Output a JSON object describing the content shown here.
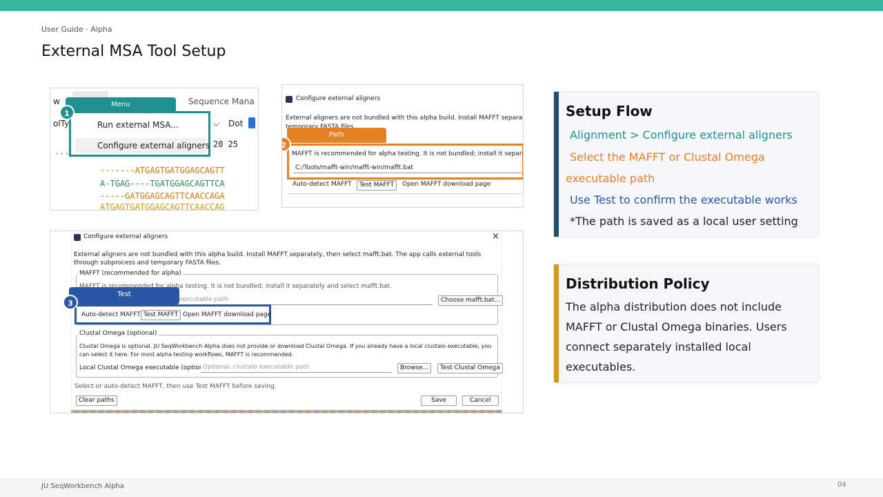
{
  "header": {
    "guide_label": "User Guide · Alpha",
    "title": "External MSA Tool Setup"
  },
  "footer": {
    "app_name": "JU SeqWorkbench Alpha",
    "page_number": "04"
  },
  "shot1": {
    "tab_sequence": "Sequence Mana",
    "menu_tag": "Menu",
    "step": "1",
    "menu_items": [
      "Run external MSA...",
      "Configure external aligners"
    ],
    "left_fragment": "olTyp",
    "dot_label": "Dot",
    "ruler": "20 25",
    "sequences": [
      "-------ATGAGTGATGGAGCAGTT",
      "A-TGAG----TGATGGAGCAGTTCA",
      "-----GATGGAGCAGTTCAACCAGA",
      "ATGAGTGATGGAGCAGTTCAACCAG"
    ]
  },
  "shot2": {
    "window_title": "Configure external aligners",
    "desc_line1": "External aligners are not bundled with this alpha build. Install MAFFT separately, t",
    "desc_line2": "temporary FASTA files.",
    "path_tag": "Path",
    "step": "2",
    "mafft_note": "MAFFT is recommended for alpha testing. It is not bundled; install it separately",
    "path_value": "C:/Tools/mafft-win/mafft-win/mafft.bat",
    "buttons": [
      "Auto-detect MAFFT",
      "Test MAFFT",
      "Open MAFFT download page"
    ]
  },
  "shot3": {
    "window_title": "Configure external aligners",
    "close_glyph": "×",
    "desc": "External aligners are not bundled with this alpha build. Install MAFFT separately, then select mafft.bat. The app calls external tools through subprocess and temporary FASTA files.",
    "mafft_group": "MAFFT (recommended for alpha)",
    "mafft_note": "MAFFT is recommended for alpha testing. It is not bundled; install it separately and select mafft.bat.",
    "test_tag": "Test",
    "step": "3",
    "path_placeholder": "executable path",
    "choose_button": "Choose mafft.bat...",
    "buttons": [
      "Auto-detect MAFFT",
      "Test MAFFT",
      "Open MAFFT download page"
    ],
    "clustal_group": "Clustal Omega (optional)",
    "clustal_desc1": "Clustal Omega is optional. JU SeqWorkbench Alpha does not provide or download Clustal Omega. If you already have a local clustalo executable, you",
    "clustal_desc2": "can select it here. For most alpha testing workflows, MAFFT is recommended.",
    "clustal_label": "Local Clustal Omega executable (optional):",
    "clustal_placeholder": "Optional: clustalo executable path",
    "browse_button": "Browse...",
    "test_clustal_button": "Test Clustal Omega",
    "hint": "Select or auto-detect MAFFT, then use Test MAFFT before saving.",
    "clear_button": "Clear paths",
    "save_button": "Save",
    "cancel_button": "Cancel"
  },
  "setup_flow": {
    "title": "Setup Flow",
    "step1": "Alignment > Configure external aligners",
    "step2a": "Select the MAFFT or Clustal Omega",
    "step2b": "executable path",
    "step3": "Use Test to confirm the executable works",
    "note": "*The path is saved as a local user setting"
  },
  "policy": {
    "title": "Distribution Policy",
    "text": "The alpha distribution does not include MAFFT or Clustal Omega binaries. Users connect separately installed local executables."
  },
  "colors": {
    "teal": "#1f8f8f",
    "orange": "#e8801f",
    "blue": "#2a56a6",
    "gold": "#d9921b",
    "navy": "#1f4e6e"
  }
}
